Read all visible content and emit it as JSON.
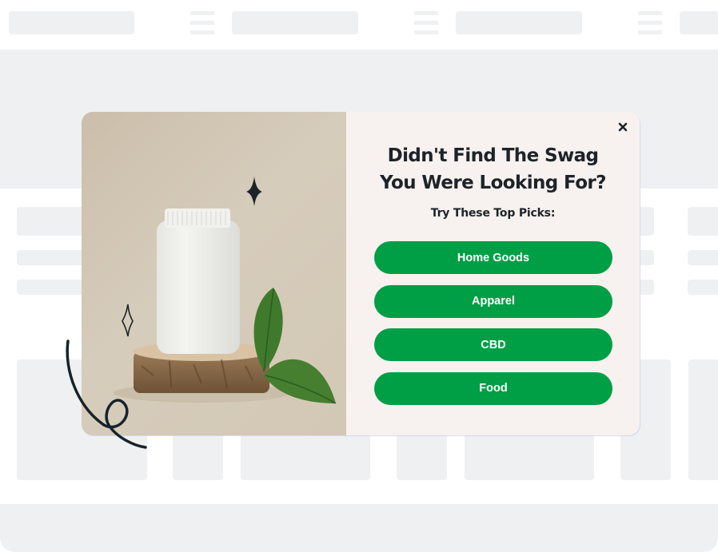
{
  "modal": {
    "headline_line1": "Didn't Find The Swag",
    "headline_line2": "You Were Looking For?",
    "subheadline": "Try These Top Picks:",
    "close_icon": "close-x-icon",
    "image_description": "white supplement bottle on wooden slice with green leaves",
    "picks": [
      {
        "label": "Home Goods"
      },
      {
        "label": "Apparel"
      },
      {
        "label": "CBD"
      },
      {
        "label": "Food"
      }
    ]
  },
  "colors": {
    "button_green": "#009f45",
    "button_text": "#ffffff",
    "headline": "#1c2329",
    "content_bg": "#f7f2ef",
    "skeleton": "#eff0f2"
  }
}
